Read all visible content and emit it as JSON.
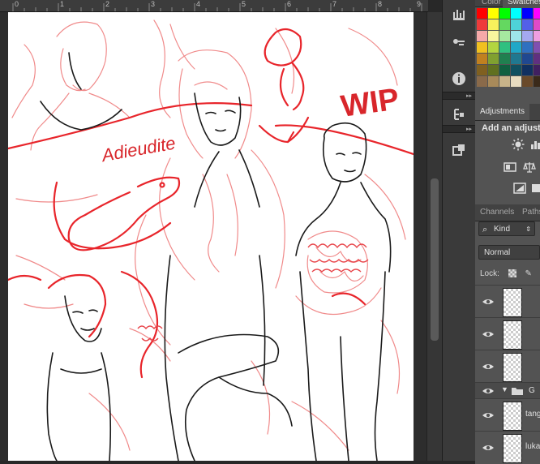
{
  "ruler": {
    "numbers": [
      "0",
      "1",
      "2",
      "3",
      "4",
      "5",
      "6",
      "7",
      "8",
      "9"
    ]
  },
  "artwork": {
    "text_name": "Adieudite",
    "text_wip": "WIP"
  },
  "tabs": {
    "color": "Color",
    "swatches": "Swatches",
    "adjustments": "Adjustments",
    "channels": "Channels",
    "paths": "Paths"
  },
  "swatch_colors": [
    "#ff0000",
    "#ffff00",
    "#00ff00",
    "#00ffff",
    "#0000ff",
    "#ff00ff",
    "#ee3b3b",
    "#f7f15c",
    "#64d860",
    "#4ed2d8",
    "#5360e8",
    "#e04ac8",
    "#f5a9a9",
    "#f9f59e",
    "#a6e9a0",
    "#9ee6ea",
    "#a4a8ef",
    "#ef9ee0",
    "#f0c020",
    "#b3d540",
    "#30c080",
    "#20a8c8",
    "#3070c0",
    "#8050b0",
    "#c08020",
    "#80a030",
    "#208050",
    "#207890",
    "#204890",
    "#603080",
    "#806020",
    "#607020",
    "#106040",
    "#105060",
    "#103060",
    "#402060",
    "#8a6a4a",
    "#a88a5a",
    "#c8b48a",
    "#e8dcc0",
    "#6a4a2a",
    "#3a2a1a"
  ],
  "adjustments": {
    "title": "Add an adjustment"
  },
  "layers": {
    "kind_label": "Kind",
    "blend_mode": "Normal",
    "lock_label": "Lock:",
    "group_label": "G",
    "items": [
      {
        "name": ""
      },
      {
        "name": ""
      },
      {
        "name": ""
      },
      {
        "name": "tang"
      },
      {
        "name": "luka"
      }
    ]
  }
}
